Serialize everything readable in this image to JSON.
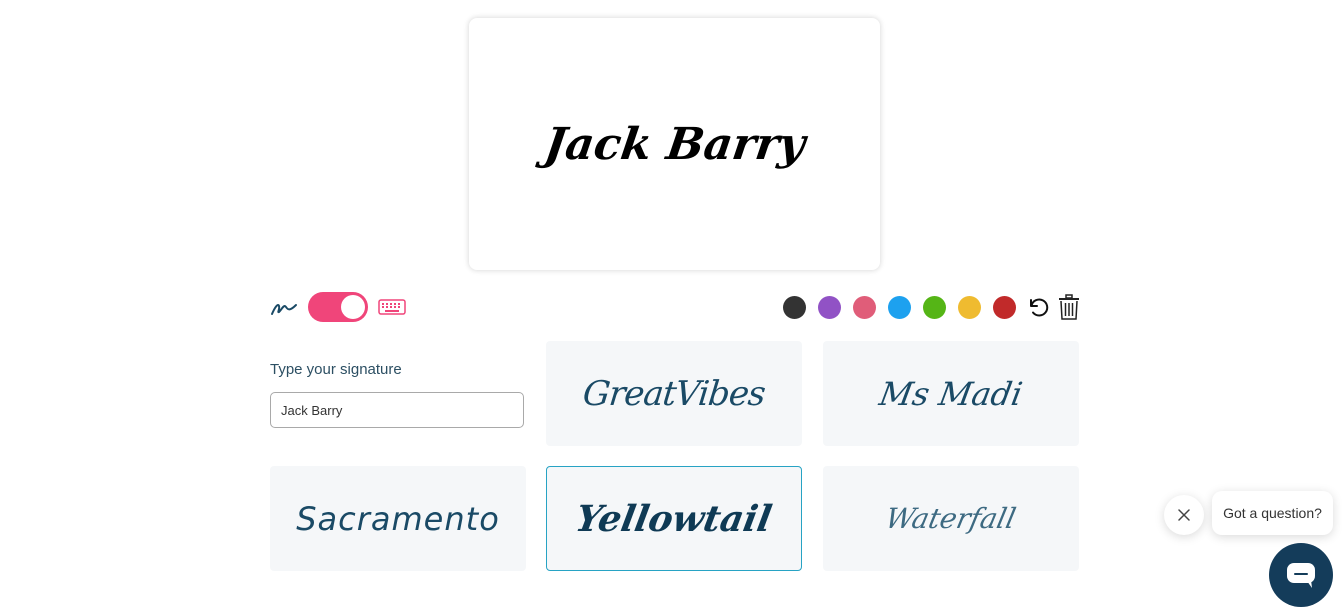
{
  "canvas": {
    "signature_text": "Jack Barry"
  },
  "mode": {
    "draw_icon": "draw-signature-icon",
    "toggle_state": "type",
    "keyboard_icon": "keyboard-icon"
  },
  "colors": {
    "swatches": [
      "#333333",
      "#9152c5",
      "#e05d79",
      "#1da1ef",
      "#55b516",
      "#efbb30",
      "#c12a2a"
    ],
    "undo_icon": "undo-icon",
    "trash_icon": "trash-icon"
  },
  "type_field": {
    "label": "Type your signature",
    "value": "Jack Barry"
  },
  "fonts": [
    {
      "name": "GreatVibes",
      "selected": false
    },
    {
      "name": "Ms Madi",
      "selected": false
    },
    {
      "name": "Sacramento",
      "selected": false
    },
    {
      "name": "Yellowtail",
      "selected": true
    },
    {
      "name": "Waterfall",
      "selected": false
    }
  ],
  "chat": {
    "prompt": "Got a question?",
    "close_icon": "close-icon",
    "launcher_icon": "chat-icon"
  },
  "accent_color": "#f0457a"
}
